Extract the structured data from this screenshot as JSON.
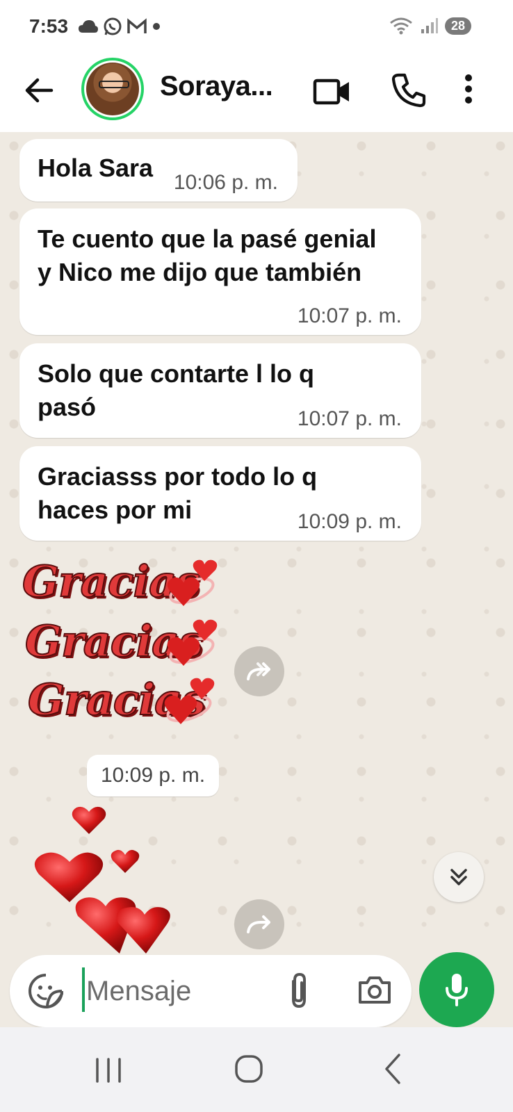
{
  "status_bar": {
    "time": "7:53",
    "battery": "28",
    "left_icons": [
      "cloud-icon",
      "whatsapp-icon",
      "gmail-icon",
      "dot-icon"
    ],
    "right_icons": [
      "wifi-icon",
      "signal-icon"
    ]
  },
  "header": {
    "contact_name": "Soraya...",
    "icons": [
      "back-arrow-icon",
      "video-call-icon",
      "phone-icon",
      "more-vert-icon"
    ]
  },
  "messages": [
    {
      "text": "Hola Sara",
      "time": "10:06 p. m."
    },
    {
      "text": "Te cuento que la pasé genial y Nico me dijo que también",
      "time": "10:07 p. m."
    },
    {
      "text": "Solo que contarte l lo q pasó",
      "time": "10:07 p. m."
    },
    {
      "text": "Graciasss por todo lo q haces por mi",
      "time": "10:09 p. m."
    }
  ],
  "sticker_gracias": {
    "lines": [
      "Gracias",
      "Gracias",
      "Gracias"
    ]
  },
  "sticker_time": "10:09 p. m.",
  "composer": {
    "placeholder": "Mensaje"
  },
  "colors": {
    "accent_green": "#1da851",
    "online_ring": "#25d366",
    "chat_background": "#efeae2",
    "bubble": "#ffffff"
  }
}
